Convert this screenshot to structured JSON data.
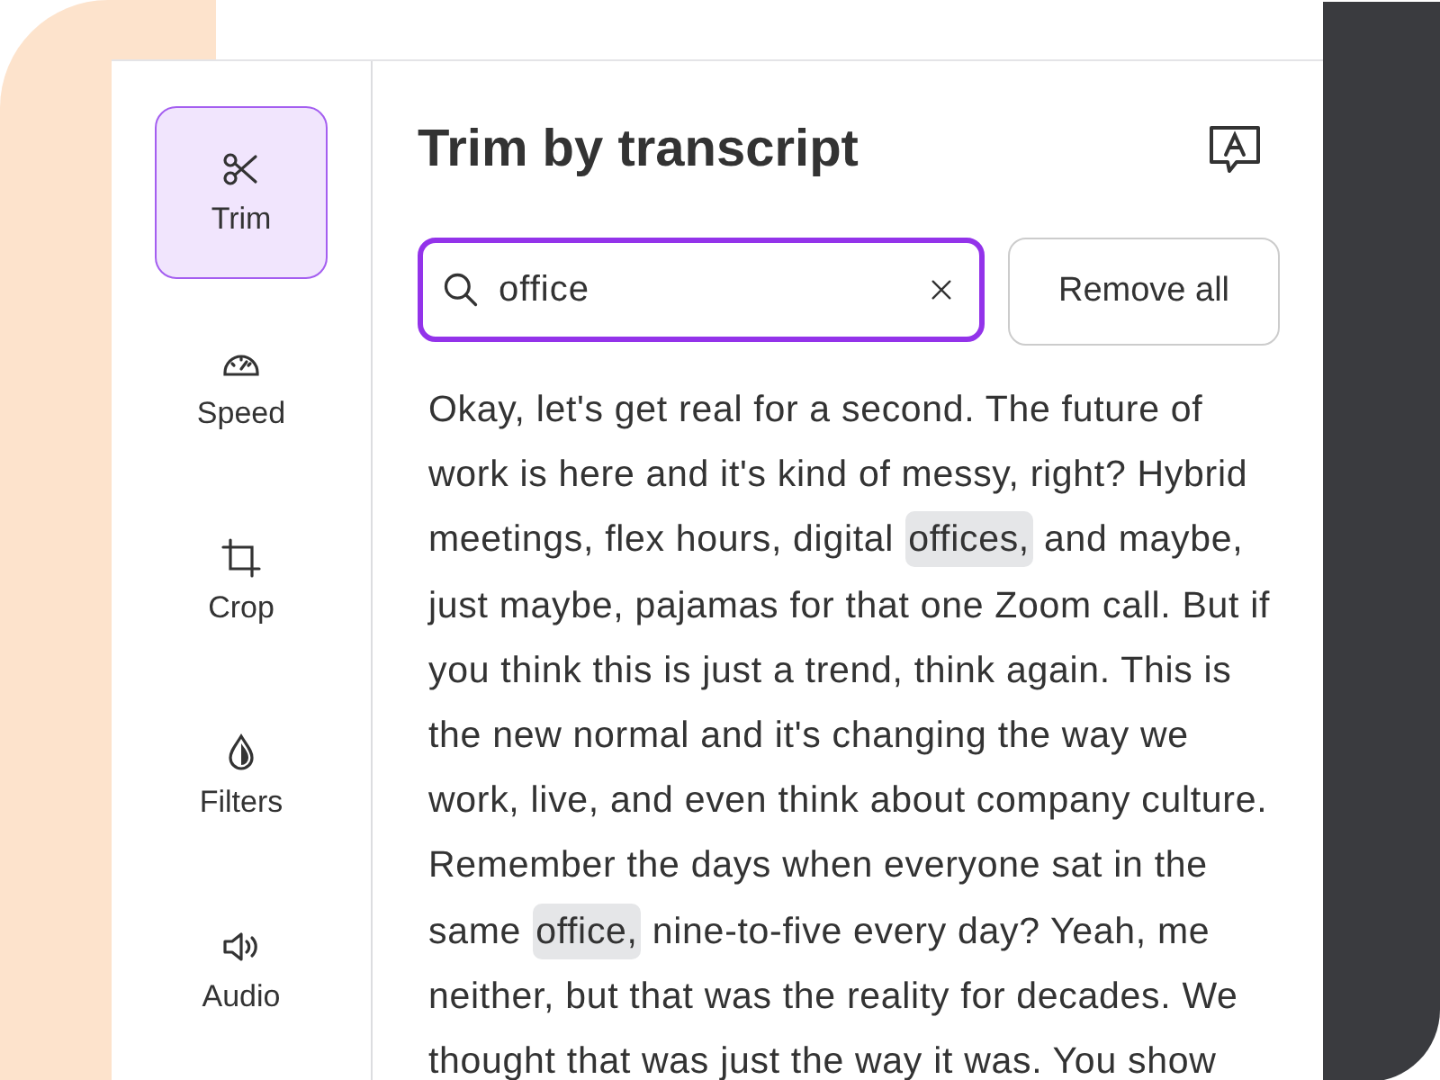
{
  "sidebar": {
    "items": [
      {
        "label": "Trim",
        "selected": true
      },
      {
        "label": "Speed",
        "selected": false
      },
      {
        "label": "Crop",
        "selected": false
      },
      {
        "label": "Filters",
        "selected": false
      },
      {
        "label": "Audio",
        "selected": false
      }
    ]
  },
  "panel": {
    "title": "Trim by transcript",
    "search": {
      "value": "office",
      "focused": true
    },
    "remove_button": "Remove all",
    "transcript": [
      {
        "text": "Okay, let's get real for a second. The future of work is here and it's kind of messy, right? Hybrid meetings, flex hours, digital ",
        "highlighted": false
      },
      {
        "text": "offices,",
        "highlighted": true
      },
      {
        "text": " and maybe, just maybe, pajamas for that one Zoom call. But if you think this is just a trend, think again. This is the new normal and it's changing the way we work, live, and even think about company culture. Remember the days when everyone sat in the same ",
        "highlighted": false
      },
      {
        "text": "office,",
        "highlighted": true
      },
      {
        "text": " nine-to-five every day? Yeah, me neither, but that was the reality for decades. We thought that was just the way it was. You show",
        "highlighted": false
      }
    ]
  }
}
